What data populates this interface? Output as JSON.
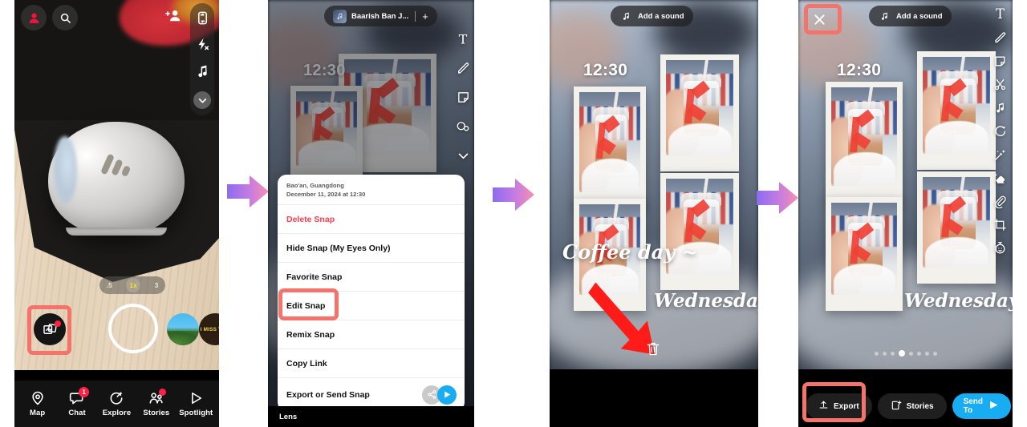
{
  "panels": [
    {
      "id": "camera",
      "name": "snapchat-camera",
      "topbar": {
        "profile_icon": "profile-avatar-icon",
        "search_icon": "search-icon",
        "add_friend_icon": "add-friend-icon"
      },
      "right_rail": [
        {
          "icon": "flip-camera-icon",
          "label": "Flip camera"
        },
        {
          "icon": "flash-off-icon",
          "label": "Flash off"
        },
        {
          "icon": "music-note-icon",
          "label": "Music"
        },
        {
          "icon": "chevron-down-icon",
          "label": "More"
        }
      ],
      "zoom_pill": {
        "options": [
          ".5",
          "1x",
          "3"
        ],
        "selected": "1x",
        "active_color": "#ffe11a"
      },
      "memories_button_badge": true,
      "story_thumbs": [
        {
          "label": "",
          "name": "story-thumb-nature"
        },
        {
          "label": "I MISS YOU",
          "name": "story-thumb-imissyou"
        }
      ],
      "highlight": {
        "target": "memories-button",
        "color": "#f4736b"
      },
      "nav": [
        {
          "label": "Map",
          "icon": "map-pin-icon",
          "badge": ""
        },
        {
          "label": "Chat",
          "icon": "chat-bubble-icon",
          "badge": "1"
        },
        {
          "label": "Explore",
          "icon": "explore-sparkle-icon",
          "badge": ""
        },
        {
          "label": "Stories",
          "icon": "stories-people-icon",
          "badge": "dot"
        },
        {
          "label": "Spotlight",
          "icon": "spotlight-play-icon",
          "badge": ""
        }
      ]
    },
    {
      "id": "snap-options",
      "name": "snap-options-sheet",
      "sound_pill": {
        "text": "Baarish Ban J...",
        "plus": "+"
      },
      "time_overlay": "12:30",
      "tool_rail": [
        "text-tool-icon",
        "draw-tool-icon",
        "sticker-tool-icon",
        "cameo-tool-icon",
        "chevron-down-icon"
      ],
      "sheet": {
        "location": "Bao'an, Guangdong",
        "datetime": "December 11, 2024 at 12:30",
        "rows": [
          {
            "label": "Delete Snap",
            "style": "danger"
          },
          {
            "label": "Hide Snap (My Eyes Only)",
            "style": "normal"
          },
          {
            "label": "Favorite Snap",
            "style": "normal"
          },
          {
            "label": "Edit Snap",
            "style": "normal",
            "highlighted": true
          },
          {
            "label": "Remix Snap",
            "style": "normal"
          },
          {
            "label": "Copy Link",
            "style": "normal"
          },
          {
            "label": "Export or Send Snap",
            "style": "normal",
            "actions": [
              "share-icon",
              "send-icon"
            ]
          }
        ]
      },
      "footer_label": "Lens",
      "highlight": {
        "target": "edit-snap-row",
        "color": "#f4736b"
      }
    },
    {
      "id": "snap-edit-drag",
      "name": "snap-edit-drag-to-delete",
      "sound_pill": {
        "text": "Add a sound"
      },
      "time_overlay": "12:30",
      "captions": [
        {
          "text": "Coffee day ~",
          "name": "caption-coffee-day"
        },
        {
          "text": "Wednesday",
          "name": "caption-wednesday"
        }
      ],
      "annotation_arrow": {
        "color": "#ff1b18",
        "points_to": "trash-icon"
      },
      "trash_icon": "trash-icon"
    },
    {
      "id": "snap-edit-export",
      "name": "snap-edit-export",
      "close_button": "close-icon",
      "sound_pill": {
        "text": "Add a sound"
      },
      "time_overlay": "12:30",
      "captions": [
        {
          "text": "Wednesday",
          "name": "caption-wednesday"
        }
      ],
      "tool_rail": [
        "text-tool-icon",
        "draw-tool-icon",
        "sticker-tool-icon",
        "scissors-tool-icon",
        "music-note-icon",
        "lens-tool-icon",
        "magic-wand-icon",
        "eraser-tool-icon",
        "attachment-paperclip-icon",
        "crop-tool-icon",
        "timer-icon"
      ],
      "page_dots": {
        "count": 8,
        "active_index": 4
      },
      "bottom_buttons": [
        {
          "label": "Export",
          "icon": "export-upload-icon",
          "style": "dark",
          "highlighted": true
        },
        {
          "label": "Stories",
          "icon": "stories-add-icon",
          "style": "dark"
        },
        {
          "label": "Send To",
          "icon": "send-arrow-icon",
          "style": "blue"
        }
      ],
      "highlights": [
        {
          "target": "close-button",
          "color": "#f4736b"
        },
        {
          "target": "export-button",
          "color": "#f4736b"
        }
      ]
    }
  ],
  "flow_arrows": [
    {
      "name": "flow-arrow-1",
      "from": "camera",
      "to": "snap-options"
    },
    {
      "name": "flow-arrow-2",
      "from": "snap-options",
      "to": "snap-edit-drag"
    },
    {
      "name": "flow-arrow-3",
      "from": "snap-edit-drag",
      "to": "snap-edit-export"
    }
  ],
  "colors": {
    "highlight": "#f4736b",
    "snapchat_blue": "#18adf3",
    "danger_red": "#ff3b4e",
    "arrow_red": "#ff1b18",
    "badge_red": "#fc2145",
    "zoom_yellow": "#ffe11a",
    "flow_arrow_start": "#9b7bf0",
    "flow_arrow_end": "#f48ab5"
  }
}
